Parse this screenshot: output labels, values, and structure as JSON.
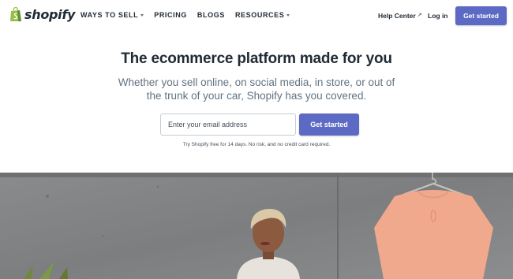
{
  "brand": {
    "name": "shopify",
    "logo_icon": "shopping-bag-icon",
    "logo_color": "#95bf47"
  },
  "nav": {
    "items": [
      {
        "label": "WAYS TO SELL",
        "has_dropdown": true
      },
      {
        "label": "PRICING",
        "has_dropdown": false
      },
      {
        "label": "BLOGS",
        "has_dropdown": false
      },
      {
        "label": "RESOURCES",
        "has_dropdown": true
      }
    ],
    "help_center": "Help Center",
    "login": "Log in",
    "cta": "Get started"
  },
  "hero": {
    "headline": "The ecommerce platform made for you",
    "subheadline": "Whether you sell online, on social media, in store, or out of the trunk of your car, Shopify has you covered.",
    "email_placeholder": "Enter your email address",
    "cta": "Get started",
    "trial_note": "Try Shopify free for 14 days. No risk, and no credit card required."
  },
  "colors": {
    "accent": "#5c6ac4",
    "text": "#212b36",
    "muted": "#637381"
  }
}
